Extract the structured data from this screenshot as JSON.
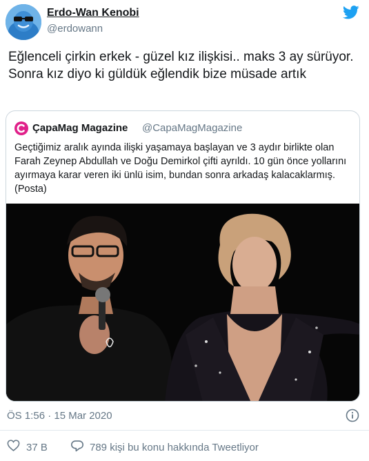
{
  "author": {
    "name": "Erdo-Wan Kenobi",
    "handle": "@erdowann"
  },
  "tweet": {
    "text": "Eğlenceli çirkin erkek - güzel kız ilişkisi.. maks 3 ay sürüyor. Sonra kız diyo ki güldük eğlendik bize müsade artık"
  },
  "quoted_tweet": {
    "name": "ÇapaMag Magazine",
    "handle": "@CapaMagMagazine",
    "text": "Geçtiğimiz aralık ayında ilişki yaşamaya başlayan ve 3 aydır birlikte olan Farah Zeynep Abdullah ve Doğu Demirkol çifti ayrıldı. 10 gün önce yollarını ayırmaya karar veren iki ünlü isim, bundan sonra arkadaş kalacaklarmış. (Posta)"
  },
  "meta": {
    "timestamp": "ÖS 1:56 · 15 Mar 2020"
  },
  "actions": {
    "like_count": "37 B",
    "reply_text": "789 kişi bu konu hakkında Tweetliyor"
  },
  "colors": {
    "twitter_blue": "#1da1f2",
    "text": "#14171a",
    "secondary_text": "#657786",
    "border": "#ccd6dd",
    "quote_brand": "#e0218a"
  },
  "icons": {
    "brand": "twitter-bird-icon",
    "info": "info-icon",
    "like": "heart-icon",
    "reply": "reply-bubble-icon"
  }
}
